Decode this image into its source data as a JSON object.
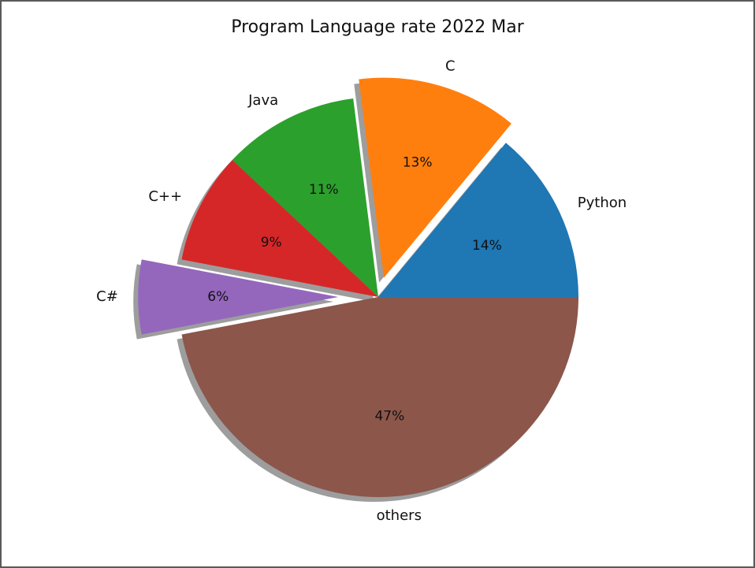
{
  "chart_data": {
    "type": "pie",
    "title": "Program Language rate 2022 Mar",
    "slices": [
      {
        "label": "Python",
        "value": 14,
        "display": "14%",
        "color": "#1f77b4",
        "explode": 0
      },
      {
        "label": "C",
        "value": 13,
        "display": "13%",
        "color": "#ff7f0e",
        "explode": 0.1
      },
      {
        "label": "Java",
        "value": 11,
        "display": "11%",
        "color": "#2ca02c",
        "explode": 0
      },
      {
        "label": "C++",
        "value": 9,
        "display": "9%",
        "color": "#d62728",
        "explode": 0
      },
      {
        "label": "C#",
        "value": 6,
        "display": "6%",
        "color": "#9467bd",
        "explode": 0.2
      },
      {
        "label": "others",
        "value": 47,
        "display": "47%",
        "color": "#8c564b",
        "explode": 0
      }
    ],
    "start_angle": 0,
    "direction": "counterclockwise",
    "shadow": true
  }
}
